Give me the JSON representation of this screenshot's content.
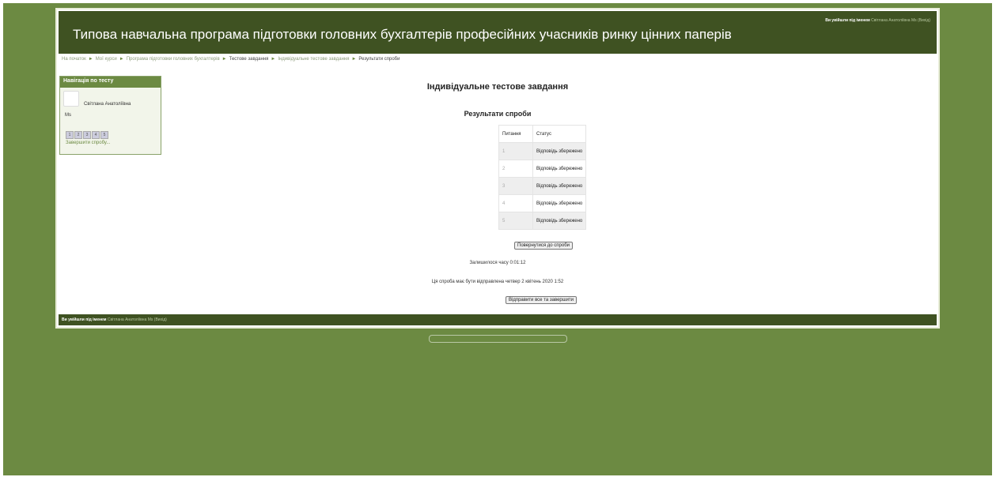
{
  "header": {
    "title": "Типова навчальна програма підготовки головних бухгалтерів професійних учасників ринку цінних паперів",
    "login_prefix": "Ви увійшли під іменем",
    "login_user": "Світлана Анатоліївна Ms (Вихід)"
  },
  "breadcrumb": {
    "items": [
      "На початок",
      "Мої курси",
      "Програма підготовки головних бухгалтерів",
      "Тестове завдання",
      "Індивідуальне тестове завдання",
      "Результати спроби"
    ]
  },
  "nav_block": {
    "title": "Навігація по тесту",
    "user_name": "Світлана Анатоліївна",
    "user_name_2": "Ms",
    "questions": [
      "1",
      "2",
      "3",
      "4",
      "5"
    ],
    "finish_link": "Завершити спробу..."
  },
  "main": {
    "heading": "Індивідуальне тестове завдання",
    "summary_heading": "Результати спроби",
    "table": {
      "headers": [
        "Питання",
        "Статус"
      ],
      "rows": [
        {
          "num": "1",
          "status": "Відповідь збережено"
        },
        {
          "num": "2",
          "status": "Відповідь збережено"
        },
        {
          "num": "3",
          "status": "Відповідь збережено"
        },
        {
          "num": "4",
          "status": "Відповідь збережено"
        },
        {
          "num": "5",
          "status": "Відповідь збережено"
        }
      ]
    },
    "return_button": "Повернутися до спроби",
    "time_left": "Залишилося часу 0:01:12",
    "auto_submit": "Ця спроба має бути відправлена четвер 2 квітень 2020 1:52",
    "finish_button": "Відправити все та завершити"
  },
  "footer": {
    "login_prefix": "Ви увійшли під іменем",
    "login_user": "Світлана Анатоліївна Ms (Вихід)"
  },
  "colors": {
    "background": "#6c8a42",
    "header": "#3f5222"
  }
}
